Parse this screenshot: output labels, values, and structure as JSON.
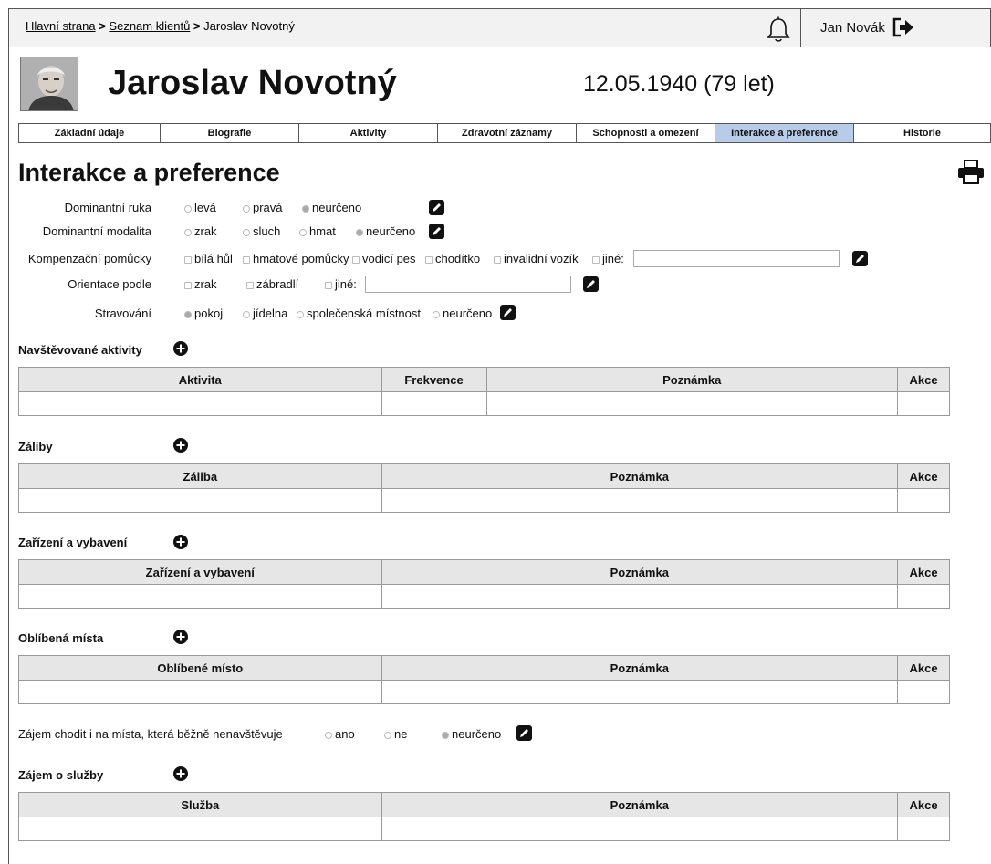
{
  "breadcrumb": {
    "home": "Hlavní strana",
    "sep1": " > ",
    "clients": "Seznam klientů",
    "sep2": " > ",
    "current": "Jaroslav Novotný"
  },
  "header": {
    "bell_icon": "bell-icon",
    "username": "Jan Novák",
    "logout_icon": "logout-icon"
  },
  "client": {
    "name": "Jaroslav Novotný",
    "birth": "12.05.1940 (79 let)",
    "avatar_icon": "avatar"
  },
  "tabs": [
    {
      "label": "Základní údaje"
    },
    {
      "label": "Biografie"
    },
    {
      "label": "Aktivity"
    },
    {
      "label": "Zdravotní záznamy"
    },
    {
      "label": "Schopnosti a omezení"
    },
    {
      "label": "Interakce a preference",
      "active": true
    },
    {
      "label": "Historie"
    }
  ],
  "section": {
    "title": "Interakce a preference",
    "print_icon": "print-icon"
  },
  "form": {
    "dominant_hand": {
      "label": "Dominantní ruka",
      "options": [
        "levá",
        "pravá",
        "neurčeno"
      ],
      "selected": "neurčeno"
    },
    "dominant_modality": {
      "label": "Dominantní modalita",
      "options": [
        "zrak",
        "sluch",
        "hmat",
        "neurčeno"
      ],
      "selected": "neurčeno"
    },
    "compensation_aids": {
      "label": "Kompenzační pomůcky",
      "options": [
        "bílá hůl",
        "hmatové pomůcky",
        "vodicí pes",
        "chodítko",
        "invalidní vozík",
        "jiné:"
      ],
      "other_value": ""
    },
    "orientation": {
      "label": "Orientace podle",
      "options": [
        "zrak",
        "zábradlí",
        "jiné:"
      ],
      "other_value": ""
    },
    "dining": {
      "label": "Stravování",
      "options": [
        "pokoj",
        "jídelna",
        "společenská místnost",
        "neurčeno"
      ],
      "selected": "pokoj"
    }
  },
  "activities": {
    "title": "Navštěvované aktivity",
    "columns": [
      "Aktivita",
      "Frekvence",
      "Poznámka",
      "Akce"
    ]
  },
  "hobbies": {
    "title": "Záliby",
    "columns": [
      "Záliba",
      "Poznámka",
      "Akce"
    ]
  },
  "equipment": {
    "title": "Zařízení a vybavení",
    "columns": [
      "Zařízení a vybavení",
      "Poznámka",
      "Akce"
    ]
  },
  "places": {
    "title": "Oblíbená místa",
    "columns": [
      "Oblíbené místo",
      "Poznámka",
      "Akce"
    ]
  },
  "interest_places": {
    "label": "Zájem chodit i na místa, která běžně nenavštěvuje",
    "options": [
      "ano",
      "ne",
      "neurčeno"
    ],
    "selected": "neurčeno"
  },
  "services": {
    "title": "Zájem o služby",
    "columns": [
      "Služba",
      "Poznámka",
      "Akce"
    ]
  },
  "colors": {
    "active_tab": "#b7cce8",
    "header_bg": "#f2f2f2",
    "table_header_bg": "#e6e6e6"
  }
}
